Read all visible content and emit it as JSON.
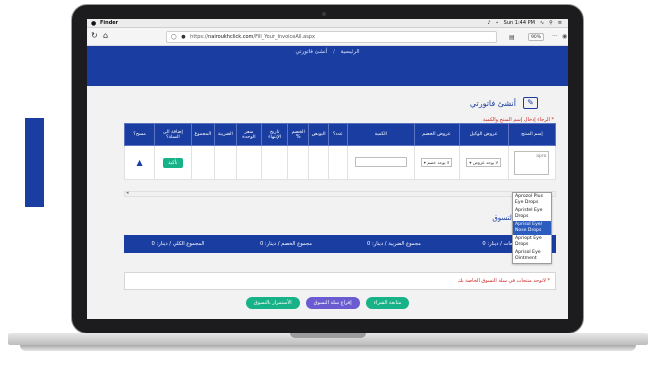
{
  "menubar": {
    "apple_icon": "apple-icon",
    "app_name": "Finder",
    "status": "Sun 1:44 PM"
  },
  "browser": {
    "url_prefix": "https://",
    "url_host": "nairoukhclick.com",
    "url_path": "/Fill_Your_InvoiceAll.aspx",
    "zoom": "90%",
    "more_glyph": "···"
  },
  "breadcrumb": {
    "home": "الرئيسية",
    "separator": "/",
    "current": "أنشئ فاتورتي"
  },
  "page": {
    "title": "أنشئ فاتورتي",
    "instruction": "* الرجاء إدخال إسم المنتج والكمية"
  },
  "table": {
    "headers": [
      "إسم المنتج",
      "عروض الوكيل",
      "عروض الخصم",
      "الكمية",
      "عدد؟",
      "البونص",
      "الخصم %",
      "تاريخ الإنتهاء",
      "سعر الوحدة",
      "الضريبة",
      "المجموع",
      "إضافة الى السلة؟",
      "مسح؟"
    ],
    "product_value": "apro",
    "agent_offer": "لا يوجد عروض",
    "discount_offer": "لا يوجد خصم",
    "confirm_label": "تأكيد"
  },
  "dropdown": {
    "items": [
      "Aprozol Plus Eye Drops",
      "Apristel Eye Drops",
      "Aprisol Eye/ Nose Drops",
      "Apriopt Eye Drops",
      "Aprisol Eye Ointment"
    ],
    "selected_index": 2
  },
  "cart": {
    "title": "سلة التسوق"
  },
  "summary": {
    "items": [
      "المبيعات / دينار: 0",
      "مجموع الضريبة / دينار: 0",
      "مجموع الخصم / دينار: 0",
      "المجموع الكلي / دينار: 0"
    ]
  },
  "notice": "* لاتوجد منتجات في سلة التسوق الخاصة بك",
  "actions": {
    "complete": "متابعة الشراء",
    "empty": "إفراغ سلة التسوق",
    "continue": "الأستمرار بالتسوق"
  },
  "colors": {
    "brand": "#1a3da1",
    "accent_green": "#18b288",
    "accent_purple": "#6b5bd1",
    "warning": "#cc2222"
  }
}
